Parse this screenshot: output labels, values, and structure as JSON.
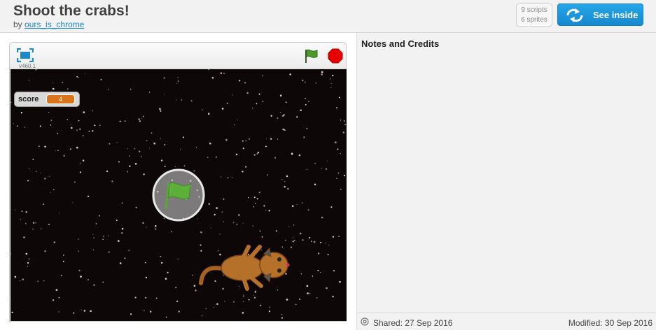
{
  "project": {
    "title": "Shoot the crabs!",
    "by_prefix": "by",
    "author": "ours_is_chrome"
  },
  "stats": {
    "scripts": "9 scripts",
    "sprites": "6 sprites"
  },
  "see_inside": {
    "label": "See inside",
    "color": "#1e9ee0"
  },
  "player": {
    "version": "v460.1",
    "fullscreen_icon": "fullscreen-icon",
    "flag_icon": "green-flag-icon",
    "stop_icon": "stop-sign-icon"
  },
  "stage": {
    "background": "#0d0708",
    "score_label": "score",
    "score_value": "4",
    "big_flag_icon": "green-flag-icon",
    "sprite": "cat-sprite"
  },
  "notes": {
    "title": "Notes and Credits"
  },
  "meta": {
    "shared": "Shared: 27 Sep 2016",
    "modified": "Modified: 30 Sep 2016"
  },
  "colors": {
    "accent": "#1e9ee0",
    "score_orange": "#d9731c",
    "flag_green": "#4c9a2a",
    "stop_red": "#e60000"
  }
}
